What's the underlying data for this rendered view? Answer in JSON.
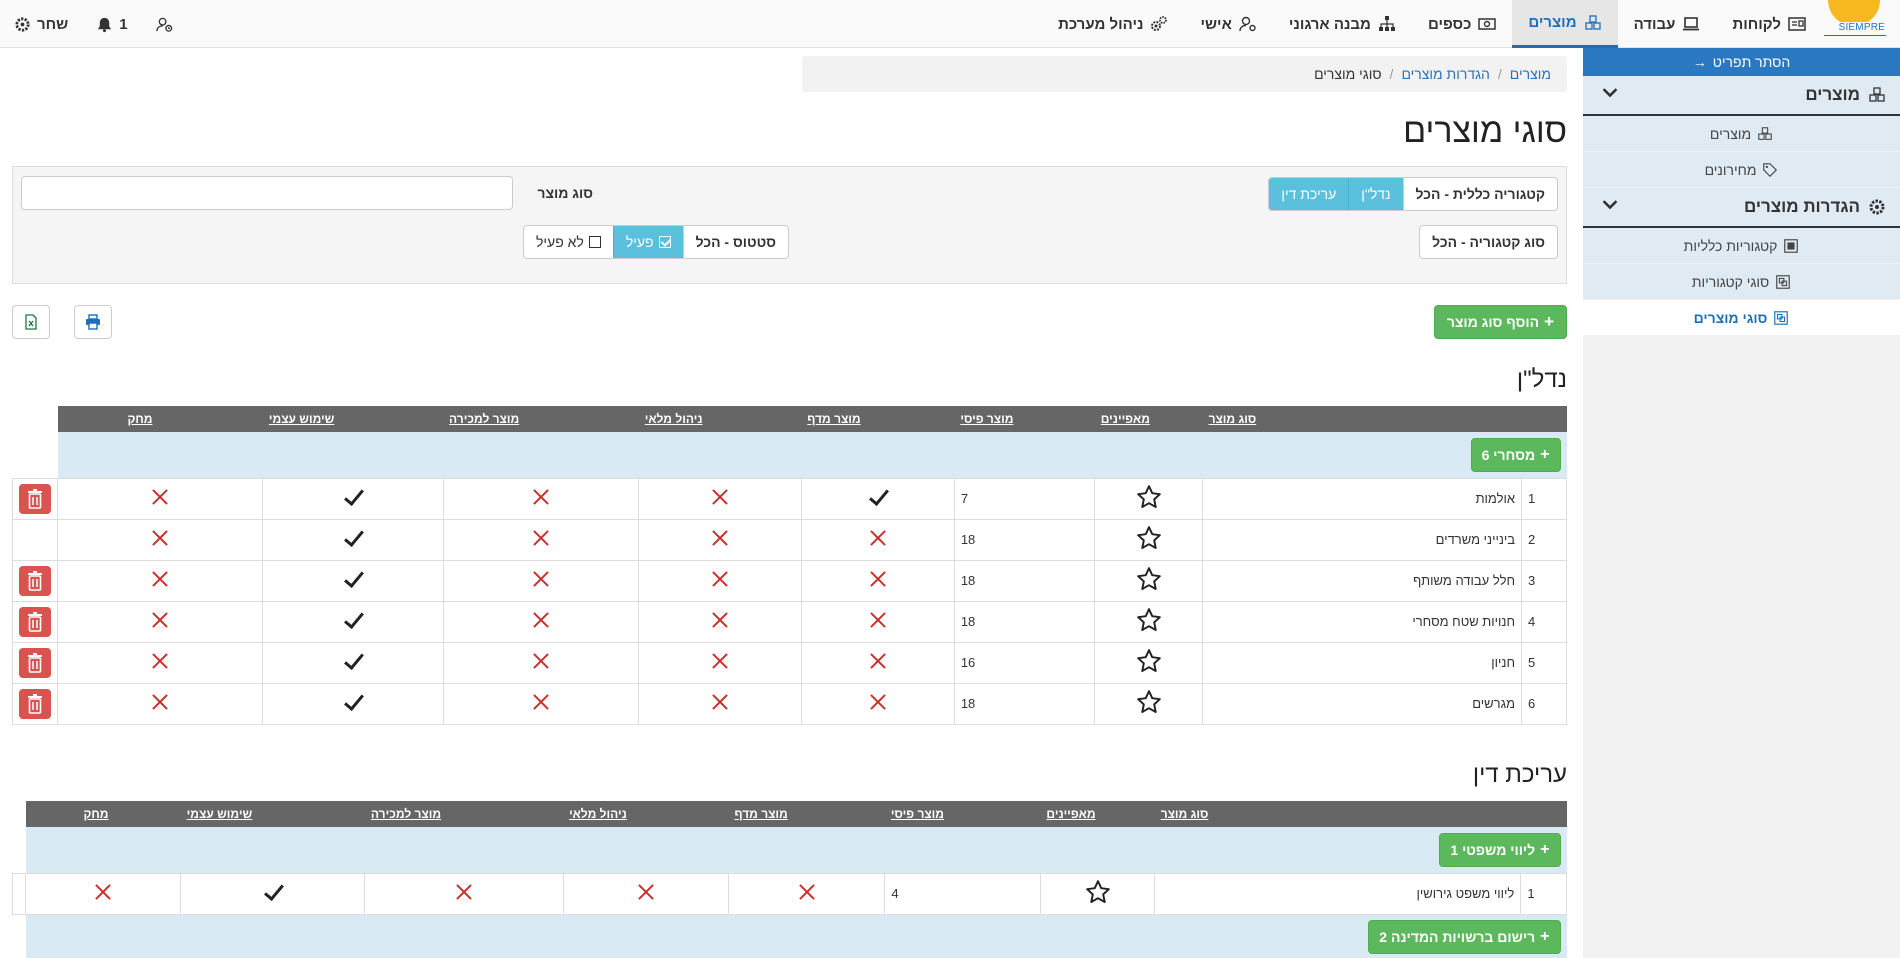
{
  "nav": {
    "logo_text": "SIEMPRE",
    "items": [
      {
        "label": "לקוחות"
      },
      {
        "label": "עבודה"
      },
      {
        "label": "מוצרים"
      },
      {
        "label": "כספים"
      },
      {
        "label": "מבנה ארגוני"
      },
      {
        "label": "אישי"
      },
      {
        "label": "ניהול מערכת"
      }
    ],
    "notifications_count": "1",
    "user": "שחר"
  },
  "sidebar": {
    "hide_menu": "הסתר תפריט",
    "sections": [
      {
        "title": "מוצרים",
        "items": [
          {
            "label": "מוצרים"
          },
          {
            "label": "מחירונים"
          }
        ]
      },
      {
        "title": "הגדרות מוצרים",
        "items": [
          {
            "label": "קטגוריות כלליות"
          },
          {
            "label": "סוגי קטגוריות"
          },
          {
            "label": "סוגי מוצרים"
          }
        ]
      }
    ]
  },
  "breadcrumb": [
    "מוצרים",
    "הגדרות מוצרים",
    "סוגי מוצרים"
  ],
  "page_title": "סוגי מוצרים",
  "filters": {
    "general_category": {
      "label": "קטגוריה כללית - הכל",
      "options": [
        "נדל\"ן",
        "עריכת דין"
      ]
    },
    "category_type": {
      "label": "סוג קטגוריה - הכל"
    },
    "product_type_label": "סוג מוצר",
    "product_type_value": "",
    "status": {
      "label": "סטטוס - הכל",
      "active": "פעיל",
      "inactive": "לא פעיל"
    }
  },
  "toolbar": {
    "add_label": "הוסף סוג מוצר"
  },
  "columns": [
    "סוג מוצר",
    "מאפיינים",
    "מוצר פיסי",
    "מוצר מדף",
    "ניהול מלאי",
    "מוצר למכירה",
    "שימוש עצמי",
    "מחק"
  ],
  "groups": [
    {
      "title": "נדל\"ן",
      "subgroups": [
        {
          "label": "מסחרי 6",
          "rows": [
            {
              "n": "1",
              "name": "אולמות",
              "count": "7",
              "flags": [
                true,
                false,
                false,
                true,
                false
              ],
              "delete": true
            },
            {
              "n": "2",
              "name": "בינייני משרדים",
              "count": "18",
              "flags": [
                false,
                false,
                false,
                true,
                false
              ],
              "delete": false
            },
            {
              "n": "3",
              "name": "חלל עבודה משותף",
              "count": "18",
              "flags": [
                false,
                false,
                false,
                true,
                false
              ],
              "delete": true
            },
            {
              "n": "4",
              "name": "חנויות שטח מסחרי",
              "count": "18",
              "flags": [
                false,
                false,
                false,
                true,
                false
              ],
              "delete": true
            },
            {
              "n": "5",
              "name": "חניון",
              "count": "16",
              "flags": [
                false,
                false,
                false,
                true,
                false
              ],
              "delete": true
            },
            {
              "n": "6",
              "name": "מגרשים",
              "count": "18",
              "flags": [
                false,
                false,
                false,
                true,
                false
              ],
              "delete": true
            }
          ]
        }
      ]
    },
    {
      "title": "עריכת דין",
      "subgroups": [
        {
          "label": "ליווי משפטי 1",
          "rows": [
            {
              "n": "1",
              "name": "ליווי משפט גירושין",
              "count": "4",
              "flags": [
                false,
                false,
                false,
                true,
                false
              ],
              "delete": false
            }
          ]
        },
        {
          "label": "רישום ברשויות המדינה 2",
          "rows": []
        }
      ]
    }
  ]
}
